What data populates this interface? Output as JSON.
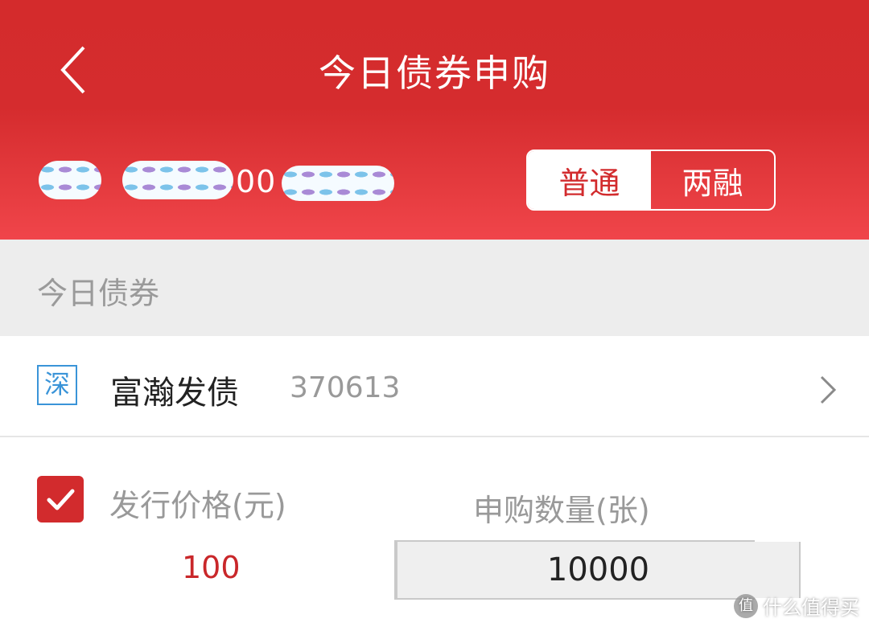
{
  "header": {
    "title": "今日债券申购",
    "account_visible": "00",
    "account_type_tabs": [
      {
        "label": "普通",
        "active": true
      },
      {
        "label": "两融",
        "active": false
      }
    ]
  },
  "section": {
    "label": "今日债券"
  },
  "bond": {
    "market_badge": "深",
    "name": "富瀚发债",
    "code": "370613"
  },
  "form": {
    "price_checked": true,
    "price_label": "发行价格(元)",
    "price_value": "100",
    "quantity_label": "申购数量(张)",
    "quantity_value": "10000"
  },
  "watermark": {
    "text": "什么值得买",
    "logo": "值"
  },
  "colors": {
    "primary": "#d42b2c",
    "price": "#c9272a",
    "market_badge": "#3a94d8"
  },
  "icons": [
    "back-arrow-icon",
    "chevron-right-icon",
    "check-icon",
    "minus-icon",
    "plus-icon"
  ]
}
